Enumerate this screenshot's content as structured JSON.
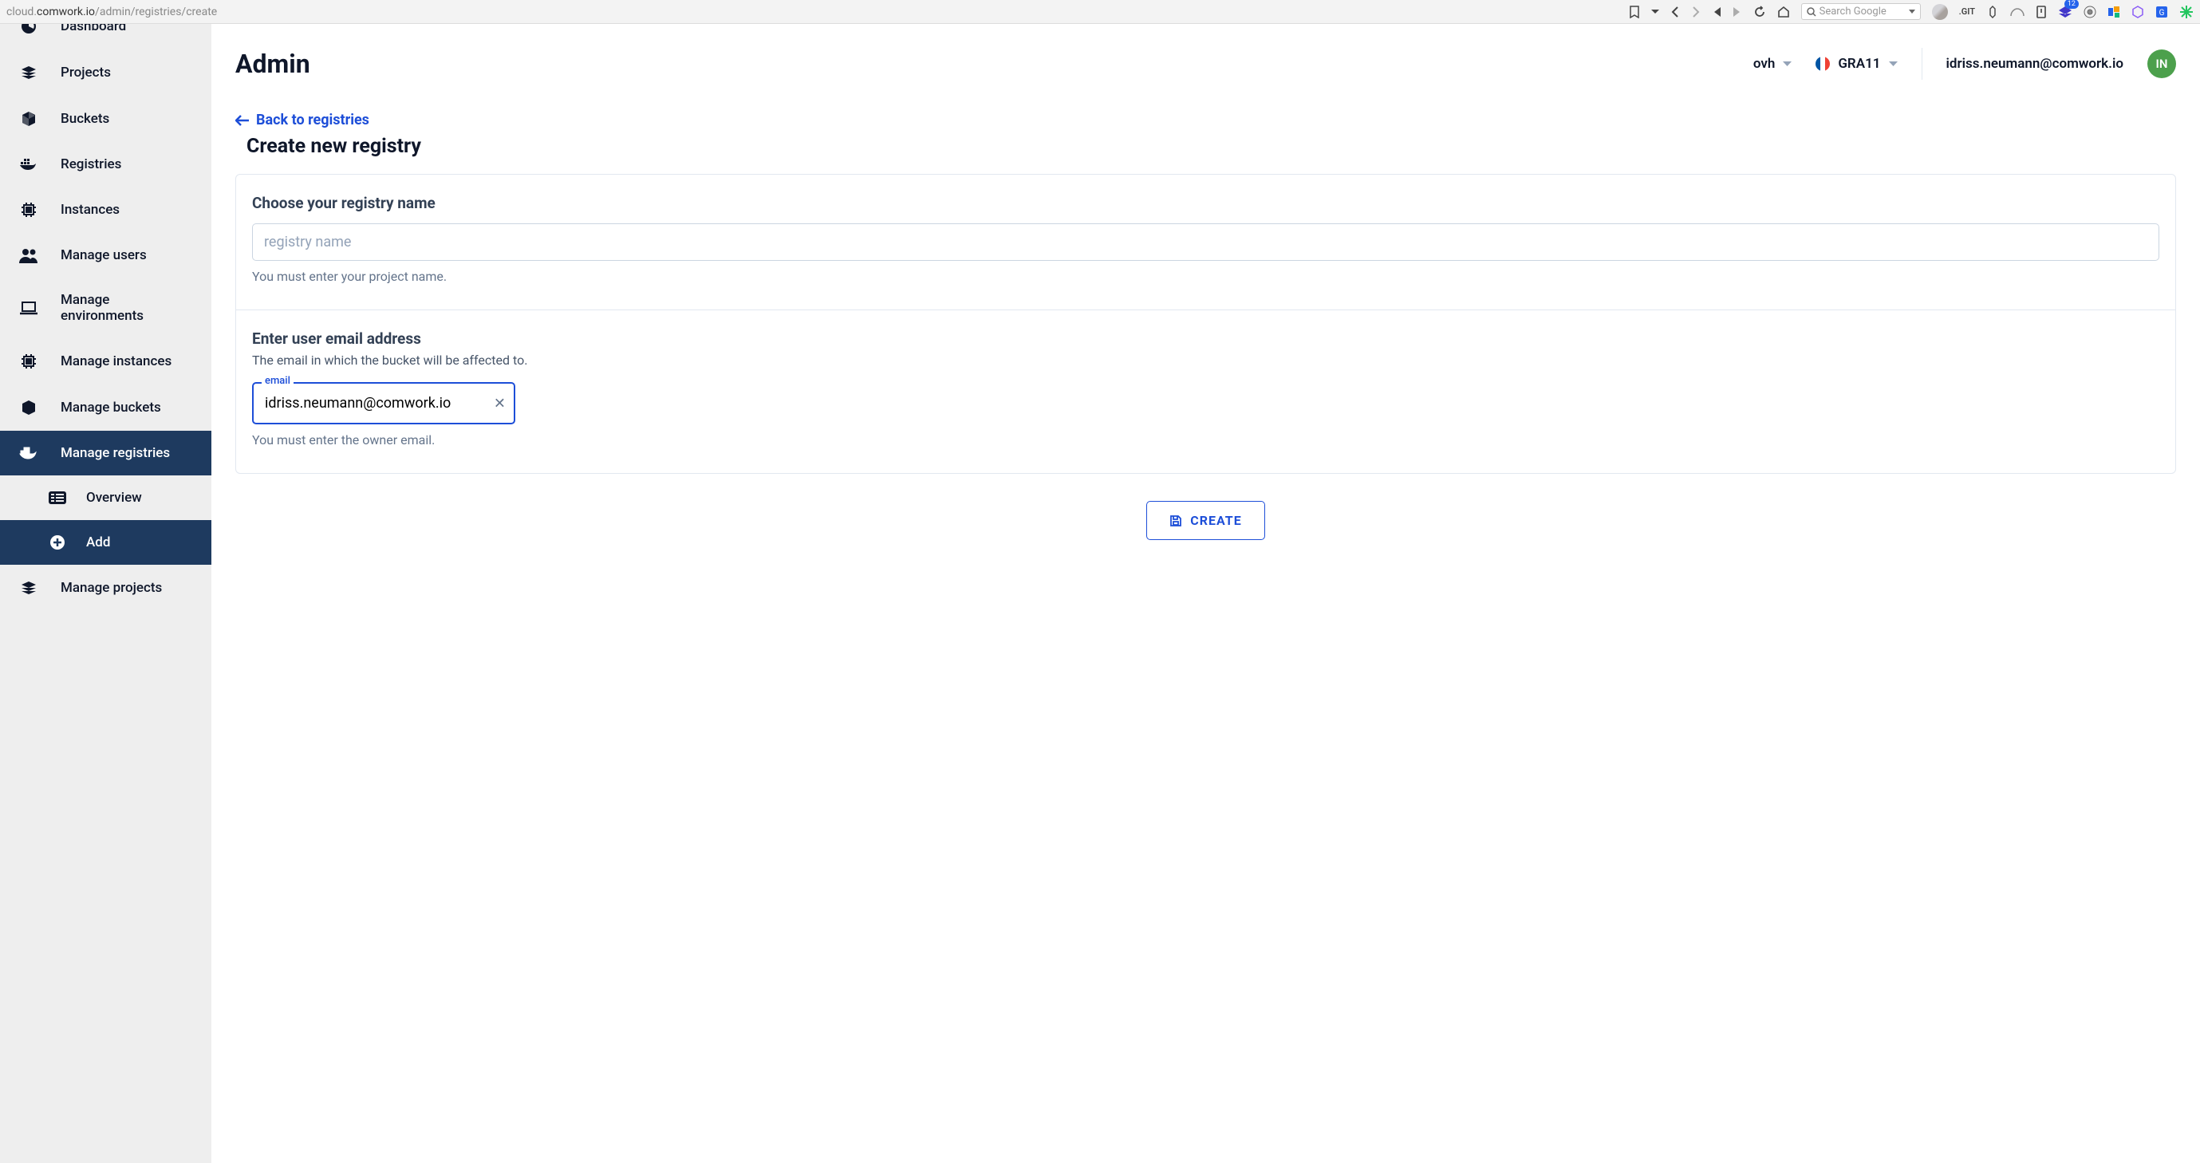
{
  "browser": {
    "url_prefix": "cloud.",
    "url_bold": "comwork.io",
    "url_suffix": "/admin/registries/create",
    "search_placeholder": "Search Google",
    "git_label": ".GIT",
    "badge_count": "12"
  },
  "sidebar": {
    "items": [
      {
        "label": "Dashboard"
      },
      {
        "label": "Projects"
      },
      {
        "label": "Buckets"
      },
      {
        "label": "Registries"
      },
      {
        "label": "Instances"
      },
      {
        "label": "Manage users"
      },
      {
        "label": "Manage environments"
      },
      {
        "label": "Manage instances"
      },
      {
        "label": "Manage buckets"
      },
      {
        "label": "Manage registries"
      },
      {
        "label": "Manage projects"
      }
    ],
    "subitems": [
      {
        "label": "Overview"
      },
      {
        "label": "Add"
      }
    ]
  },
  "header": {
    "title": "Admin",
    "provider": "ovh",
    "region": "GRA11",
    "email": "idriss.neumann@comwork.io",
    "avatar_initials": "IN"
  },
  "page": {
    "back_label": "Back to registries",
    "subtitle": "Create new registry",
    "section1": {
      "title": "Choose your registry name",
      "placeholder": "registry name",
      "helper": "You must enter your project name."
    },
    "section2": {
      "title": "Enter user email address",
      "sub": "The email in which the bucket will be affected to.",
      "email_label": "email",
      "email_value": "idriss.neumann@comwork.io",
      "helper": "You must enter the owner email."
    },
    "create_label": "CREATE"
  }
}
